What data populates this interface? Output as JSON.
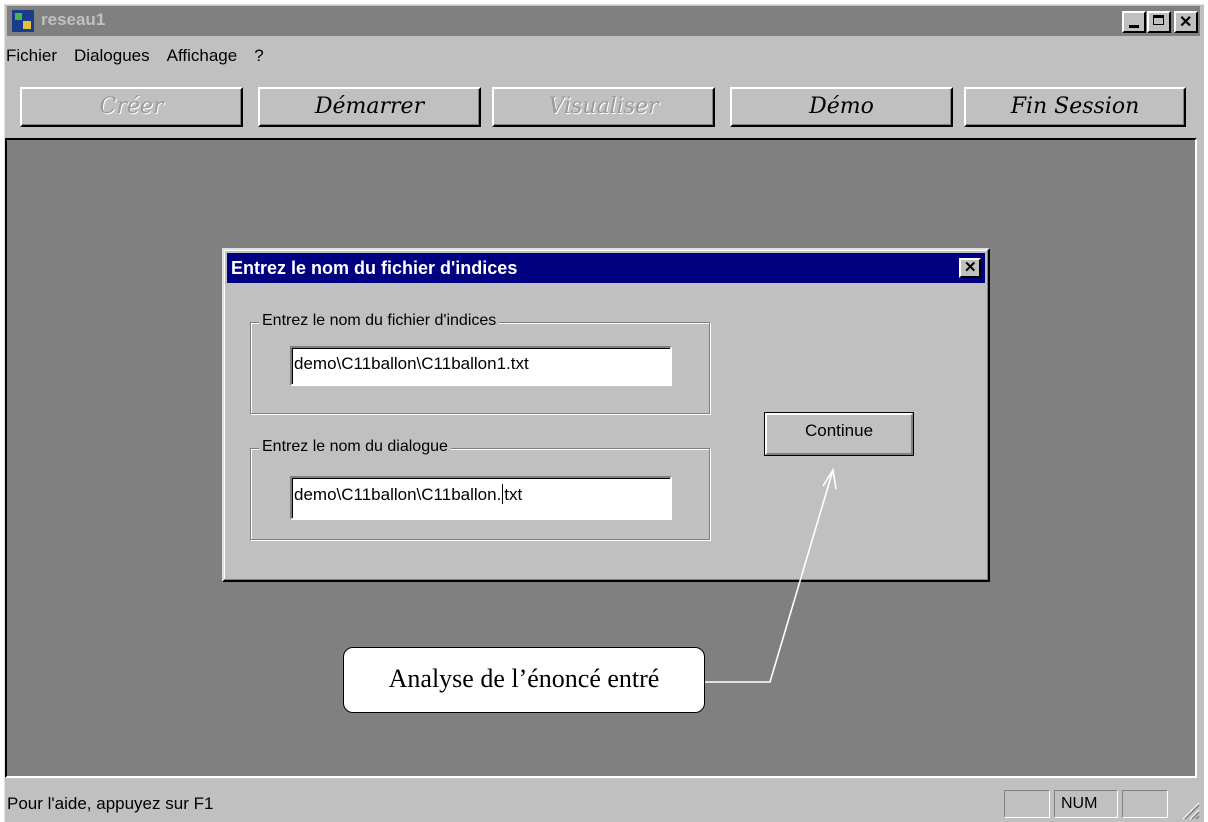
{
  "window": {
    "title": "reseau1"
  },
  "menu": {
    "items": [
      "Fichier",
      "Dialogues",
      "Affichage",
      "?"
    ]
  },
  "toolbar": {
    "buttons": [
      {
        "label": "Créer",
        "enabled": false
      },
      {
        "label": "Démarrer",
        "enabled": true
      },
      {
        "label": "Visualiser",
        "enabled": false
      },
      {
        "label": "Démo",
        "enabled": true
      },
      {
        "label": "Fin Session",
        "enabled": true
      }
    ]
  },
  "dialog": {
    "title": "Entrez le nom du fichier d'indices",
    "group1": {
      "label": "Entrez le nom du fichier d'indices",
      "value": "demo\\C11ballon\\C11ballon1.txt"
    },
    "group2": {
      "label": "Entrez le nom du dialogue",
      "value_before_cursor": "demo\\C11ballon\\C11ballon.",
      "value_after_cursor": "txt"
    },
    "continue_label": "Continue"
  },
  "callout": {
    "text": "Analyse de l’énoncé entré"
  },
  "statusbar": {
    "text": "Pour l'aide, appuyez sur F1",
    "num_indicator": "NUM"
  },
  "colors": {
    "client_bg": "#808080",
    "dialog_title_bg": "#000080",
    "face": "#c0c0c0"
  }
}
